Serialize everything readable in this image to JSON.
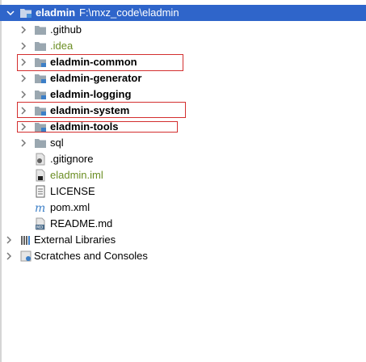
{
  "tree": {
    "root": {
      "label": "eladmin",
      "path": "F:\\mxz_code\\eladmin"
    },
    "items": [
      {
        "label": ".github"
      },
      {
        "label": ".idea"
      },
      {
        "label": "eladmin-common"
      },
      {
        "label": "eladmin-generator"
      },
      {
        "label": "eladmin-logging"
      },
      {
        "label": "eladmin-system"
      },
      {
        "label": "eladmin-tools"
      },
      {
        "label": "sql"
      },
      {
        "label": ".gitignore"
      },
      {
        "label": "eladmin.iml"
      },
      {
        "label": "LICENSE"
      },
      {
        "label": "pom.xml"
      },
      {
        "label": "README.md"
      }
    ],
    "external_libraries": "External Libraries",
    "scratches": "Scratches and Consoles"
  },
  "colors": {
    "selection": "#2f65ca",
    "highlight_box": "#d32f2f",
    "idea_text": "#6b8e23"
  }
}
